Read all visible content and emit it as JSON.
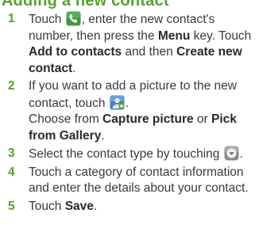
{
  "section": {
    "heading": "Adding a new contact"
  },
  "steps": [
    {
      "num": "1",
      "t1": "Touch",
      "t2": ", enter the new contact's number, then press the",
      "b1": "Menu",
      "t3": "key. Touch",
      "b2": "Add to contacts",
      "t4": "and then",
      "b3": "Create new contact",
      "t5": "."
    },
    {
      "num": "2",
      "t1": "If you want to add a picture to the new contact, touch",
      "t2": ".",
      "t3": "Choose from",
      "b1": "Capture picture",
      "t4": "or",
      "b2": "Pick from Gallery",
      "t5": "."
    },
    {
      "num": "3",
      "t1": "Select the contact type by touching",
      "t2": "."
    },
    {
      "num": "4",
      "t1": "Touch a category of contact information and enter the details about your contact."
    },
    {
      "num": "5",
      "t1": "Touch",
      "b1": "Save",
      "t2": "."
    }
  ],
  "icons": {
    "phone": "phone-icon",
    "picture": "contact-picture-icon",
    "dropdown": "dropdown-arrow-icon"
  },
  "colors": {
    "accent": "#5aa02c",
    "text": "#3a3a3a",
    "phone_icon": "#3b9a3b",
    "picture_icon": "#4a7fc0",
    "dropdown_icon": "#8a8a8a"
  }
}
